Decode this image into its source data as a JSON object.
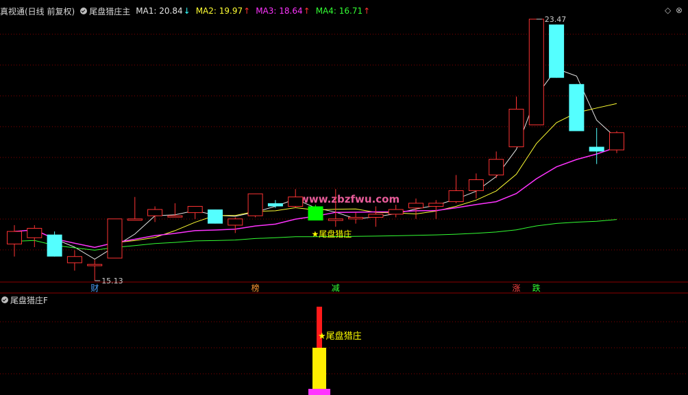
{
  "header": {
    "title": "真视通(日线 前复权)",
    "indicator": "尾盘猎庄主",
    "ma": [
      {
        "label": "MA1:",
        "value": "20.84",
        "arrow": "↓",
        "color": "#e6e6e6"
      },
      {
        "label": "MA2:",
        "value": "19.97",
        "arrow": "↑",
        "color": "#ffff33"
      },
      {
        "label": "MA3:",
        "value": "18.64",
        "arrow": "↑",
        "color": "#ff33ff"
      },
      {
        "label": "MA4:",
        "value": "16.71",
        "arrow": "↑",
        "color": "#33ff33"
      }
    ],
    "controls": [
      "◇",
      "⊗"
    ]
  },
  "chart_data": {
    "type": "candlestick",
    "candles": [
      {
        "o": 16.3,
        "h": 16.9,
        "l": 15.9,
        "c": 16.7
      },
      {
        "o": 16.5,
        "h": 16.9,
        "l": 16.2,
        "c": 16.8
      },
      {
        "o": 16.6,
        "h": 16.7,
        "l": 15.9,
        "c": 15.9
      },
      {
        "o": 15.7,
        "h": 16.1,
        "l": 15.45,
        "c": 15.9
      },
      {
        "o": 15.65,
        "h": 15.8,
        "l": 15.13,
        "c": 15.65
      },
      {
        "o": 15.85,
        "h": 17.1,
        "l": 15.85,
        "c": 17.1
      },
      {
        "o": 17.1,
        "h": 17.8,
        "l": 17.1,
        "c": 17.1
      },
      {
        "o": 17.2,
        "h": 17.5,
        "l": 17.0,
        "c": 17.4
      },
      {
        "o": 17.2,
        "h": 17.6,
        "l": 17.2,
        "c": 17.2
      },
      {
        "o": 17.3,
        "h": 17.5,
        "l": 17.1,
        "c": 17.5
      },
      {
        "o": 17.4,
        "h": 17.4,
        "l": 16.95,
        "c": 16.95
      },
      {
        "o": 16.9,
        "h": 17.15,
        "l": 16.65,
        "c": 17.1
      },
      {
        "o": 17.2,
        "h": 17.9,
        "l": 17.15,
        "c": 17.9
      },
      {
        "o": 17.6,
        "h": 17.7,
        "l": 17.45,
        "c": 17.5
      },
      {
        "o": 17.5,
        "h": 18.05,
        "l": 17.45,
        "c": 17.8
      },
      {
        "o": 17.5,
        "h": 17.55,
        "l": 17.05,
        "c": 17.05
      },
      {
        "o": 17.05,
        "h": 18.05,
        "l": 16.85,
        "c": 17.1
      },
      {
        "o": 17.1,
        "h": 17.3,
        "l": 16.95,
        "c": 17.15
      },
      {
        "o": 17.15,
        "h": 17.5,
        "l": 16.85,
        "c": 17.25
      },
      {
        "o": 17.25,
        "h": 17.55,
        "l": 17.15,
        "c": 17.4
      },
      {
        "o": 17.45,
        "h": 17.75,
        "l": 17.1,
        "c": 17.6
      },
      {
        "o": 17.5,
        "h": 17.7,
        "l": 17.1,
        "c": 17.6
      },
      {
        "o": 17.65,
        "h": 18.5,
        "l": 17.6,
        "c": 18.0
      },
      {
        "o": 18.0,
        "h": 18.55,
        "l": 17.75,
        "c": 18.35
      },
      {
        "o": 18.5,
        "h": 19.25,
        "l": 18.4,
        "c": 19.0
      },
      {
        "o": 19.4,
        "h": 21.0,
        "l": 19.4,
        "c": 20.6
      },
      {
        "o": 20.1,
        "h": 23.47,
        "l": 20.1,
        "c": 23.47
      },
      {
        "o": 23.3,
        "h": 23.3,
        "l": 21.6,
        "c": 21.6
      },
      {
        "o": 21.4,
        "h": 21.4,
        "l": 19.9,
        "c": 19.9
      },
      {
        "o": 19.4,
        "h": 20.0,
        "l": 18.85,
        "c": 19.25
      },
      {
        "o": 19.3,
        "h": 19.9,
        "l": 19.2,
        "c": 19.85
      }
    ],
    "annotations": {
      "high": "23.47",
      "low": "15.13",
      "signal": "★尾盘猎庄"
    },
    "events": [
      {
        "label": "财",
        "color": "#4aa3ff",
        "at": 4
      },
      {
        "label": "榜",
        "color": "#ff9933",
        "at": 12
      },
      {
        "label": "减",
        "color": "#33ff33",
        "at": 16
      },
      {
        "label": "涨",
        "color": "#ff4444",
        "at": 25
      },
      {
        "label": "跌",
        "color": "#33ff33",
        "at": 26
      }
    ]
  },
  "sub_panel": {
    "title": "尾盘猎庄F",
    "signal": "★尾盘猎庄"
  },
  "watermark": "www.zbzfwu.com",
  "colors": {
    "up": "#ff3333",
    "down": "#54ffff",
    "signal_down": "#00ff00",
    "grid": "#8b0000",
    "signal_text": "#ffff00"
  }
}
